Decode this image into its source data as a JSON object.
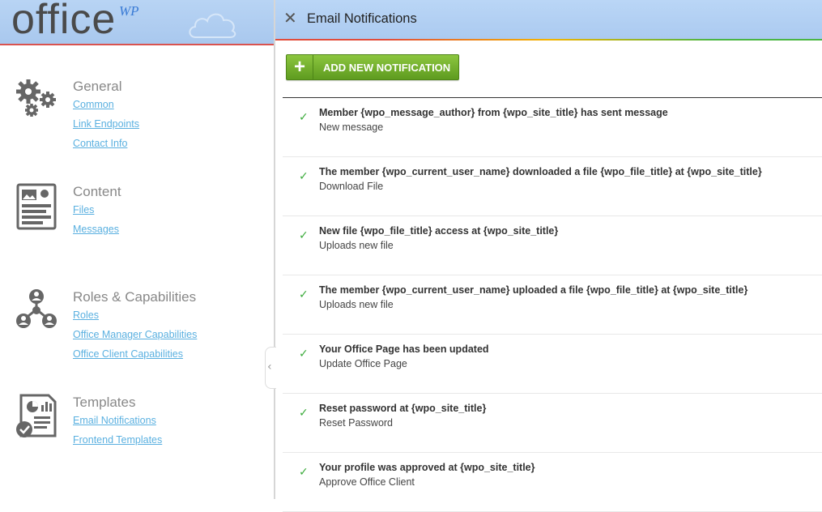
{
  "logo": {
    "text": "office",
    "superscript": "WP"
  },
  "sidebar": {
    "sections": [
      {
        "title": "General",
        "icon": "gears-icon",
        "links": [
          "Common",
          "Link Endpoints",
          "Contact Info"
        ]
      },
      {
        "title": "Content",
        "icon": "document-icon",
        "links": [
          "Files",
          "Messages"
        ]
      },
      {
        "title": "Roles & Capabilities",
        "icon": "roles-hierarchy-icon",
        "links": [
          "Roles",
          "Office Manager Capabilities",
          "Office Client Capabilities"
        ]
      },
      {
        "title": "Templates",
        "icon": "template-checklist-icon",
        "links": [
          "Email Notifications",
          "Frontend Templates"
        ]
      }
    ]
  },
  "panel": {
    "close": "✕",
    "title": "Email Notifications",
    "add_button": "ADD NEW NOTIFICATION",
    "add_icon": "+",
    "check_glyph": "✓",
    "notifications": [
      {
        "title": "Member {wpo_message_author} from {wpo_site_title} has sent message",
        "subtitle": "New message"
      },
      {
        "title": "The member {wpo_current_user_name} downloaded a file {wpo_file_title} at {wpo_site_title}",
        "subtitle": "Download File"
      },
      {
        "title": "New file {wpo_file_title} access at {wpo_site_title}",
        "subtitle": "Uploads new file"
      },
      {
        "title": "The member {wpo_current_user_name} uploaded a file {wpo_file_title} at {wpo_site_title}",
        "subtitle": "Uploads new file"
      },
      {
        "title": "Your Office Page has been updated",
        "subtitle": "Update Office Page"
      },
      {
        "title": "Reset password at {wpo_site_title}",
        "subtitle": "Reset Password"
      },
      {
        "title": "Your profile was approved at {wpo_site_title}",
        "subtitle": "Approve Office Client"
      }
    ]
  },
  "colors": {
    "header_bg": "#abcaf0",
    "accent_red": "#e24c3c",
    "button_green": "#6aa829",
    "link": "#5ab0e0",
    "check": "#3cab3c"
  }
}
